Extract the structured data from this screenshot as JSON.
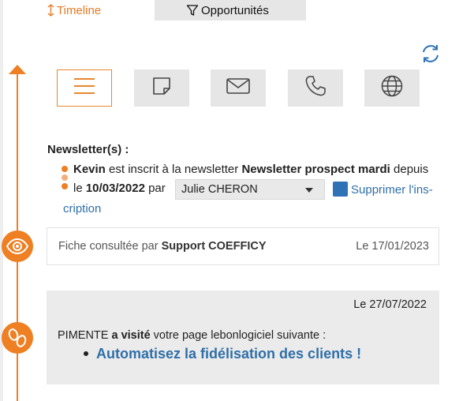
{
  "tabs": [
    {
      "label": "Timeline",
      "icon": "sort-arrows-icon",
      "active": true
    },
    {
      "label": "Opportunités",
      "icon": "filter-icon",
      "active": false
    }
  ],
  "actions": [
    {
      "name": "menu-icon",
      "active": true
    },
    {
      "name": "note-icon",
      "active": false
    },
    {
      "name": "mail-icon",
      "active": false
    },
    {
      "name": "phone-icon",
      "active": false
    },
    {
      "name": "globe-icon",
      "active": false
    }
  ],
  "newsletter": {
    "title": "Newsletter(s) :",
    "contact": "Kevin",
    "text1": " est inscrit à la newsletter ",
    "newsletter_name": "Newsletter prospect mardi",
    "text2": " depuis",
    "text3": "le ",
    "date": "10/03/2022",
    "text4": " par",
    "user": "Julie CHERON",
    "delete_label_1": "Supprimer l'ins-",
    "delete_label_2": "cription"
  },
  "events": {
    "view": {
      "prefix": "Fiche consultée par ",
      "user": "Support COEFFICY",
      "date": "Le 17/01/2023"
    },
    "visit": {
      "date": "Le 27/07/2022",
      "who": "PIMENTE ",
      "action": "a visité",
      "rest": " votre page lebonlogiciel suivante :",
      "link": "Automatisez la fidélisation des clients !"
    }
  },
  "colors": {
    "accent": "#ee7f22",
    "link": "#2f6fa8",
    "card_bg": "#ebebeb",
    "tab_inactive": "#e6e6e6"
  }
}
